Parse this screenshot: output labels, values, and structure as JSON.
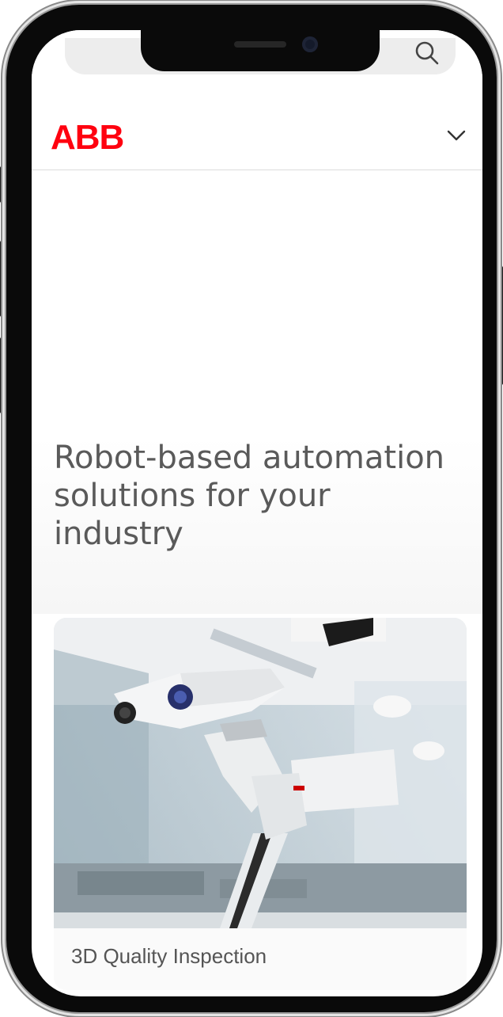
{
  "header": {
    "logo_text": "ABB",
    "brand_color": "#ff000f",
    "menu_icon": "chevron-down-icon"
  },
  "top_bar": {
    "search_icon": "search-icon"
  },
  "hero": {
    "title": "Robot-based automation solutions for your industry"
  },
  "card": {
    "image": "industrial-robot-arm-photo",
    "label": "3D Quality Inspection"
  }
}
